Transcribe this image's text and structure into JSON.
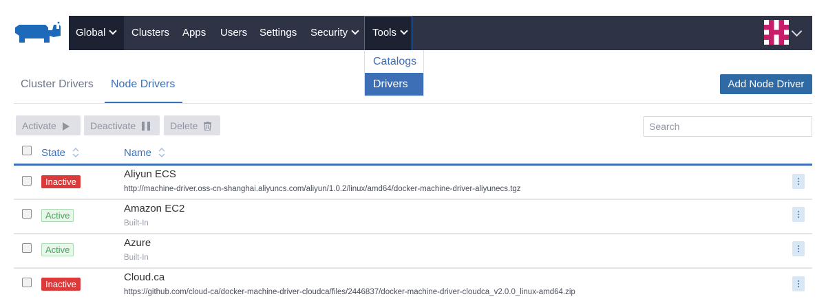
{
  "nav": {
    "global": "Global",
    "items": [
      "Clusters",
      "Apps",
      "Users",
      "Settings",
      "Security"
    ],
    "tools": "Tools"
  },
  "tools_menu": {
    "items": [
      "Catalogs",
      "Drivers"
    ],
    "selected": "Drivers"
  },
  "tabs": {
    "cluster_drivers": "Cluster Drivers",
    "node_drivers": "Node Drivers",
    "active": "Node Drivers"
  },
  "add_button": "Add Node Driver",
  "bulk": {
    "activate": "Activate",
    "deactivate": "Deactivate",
    "delete": "Delete"
  },
  "search": {
    "placeholder": "Search",
    "value": ""
  },
  "table": {
    "headers": {
      "state": "State",
      "name": "Name"
    },
    "rows": [
      {
        "state": "Inactive",
        "name": "Aliyun ECS",
        "url": "http://machine-driver.oss-cn-shanghai.aliyuncs.com/aliyun/1.0.2/linux/amd64/docker-machine-driver-aliyunecs.tgz"
      },
      {
        "state": "Active",
        "name": "Amazon EC2",
        "url": "Built-In"
      },
      {
        "state": "Active",
        "name": "Azure",
        "url": "Built-In"
      },
      {
        "state": "Inactive",
        "name": "Cloud.ca",
        "url": "https://github.com/cloud-ca/docker-machine-driver-cloudca/files/2446837/docker-machine-driver-cloudca_v2.0.0_linux-amd64.zip"
      }
    ]
  },
  "colors": {
    "nav_bg": "#2e3446",
    "accent": "#3d6fb6",
    "primary_button": "#2f6aa4",
    "inactive_badge": "#da3a3a",
    "active_badge": "#4aa557"
  }
}
